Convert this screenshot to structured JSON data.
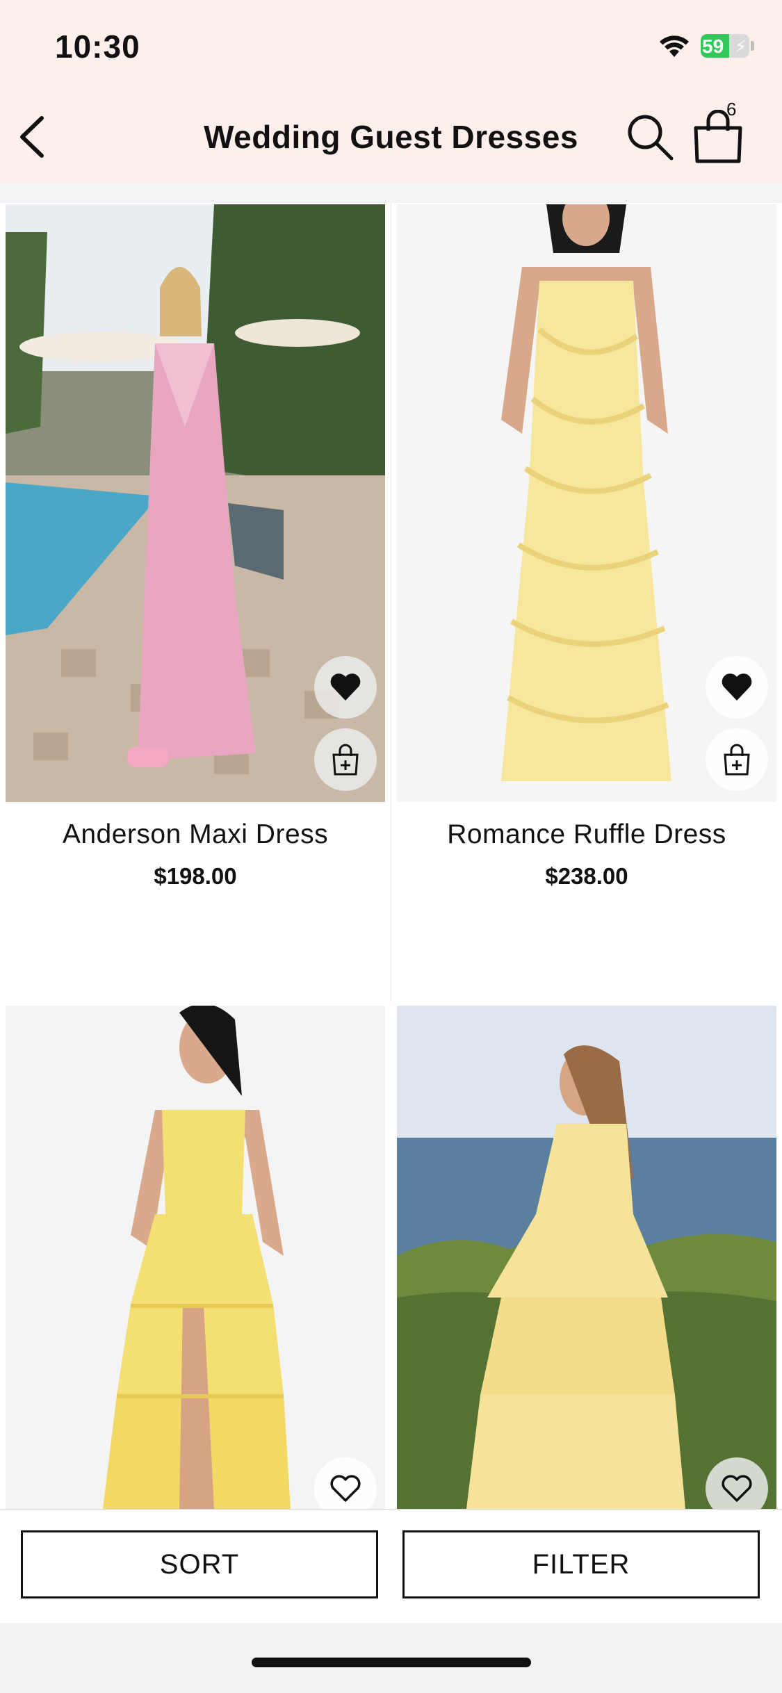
{
  "status_bar": {
    "time": "10:30",
    "battery": "59",
    "battery_level": 0.59
  },
  "header": {
    "title": "Wedding Guest Dresses",
    "cart_count": "6"
  },
  "products": [
    {
      "name": "Anderson Maxi Dress",
      "price": "$198.00",
      "favorited": true,
      "dress_color": "#e8a6c0"
    },
    {
      "name": "Romance Ruffle Dress",
      "price": "$238.00",
      "favorited": true,
      "dress_color": "#f7e79c"
    },
    {
      "name": "",
      "price": "",
      "favorited": false,
      "dress_color": "#f4df72"
    },
    {
      "name": "",
      "price": "",
      "favorited": false,
      "dress_color": "#f5e39a"
    }
  ],
  "bottom_bar": {
    "sort_label": "SORT",
    "filter_label": "FILTER"
  },
  "icons": [
    "back-chevron-icon",
    "search-icon",
    "shopping-bag-icon",
    "heart-icon",
    "add-to-bag-icon",
    "wifi-icon",
    "battery-icon"
  ],
  "colors": {
    "header_bg": "#fdefec",
    "accent_battery": "#34c759"
  }
}
